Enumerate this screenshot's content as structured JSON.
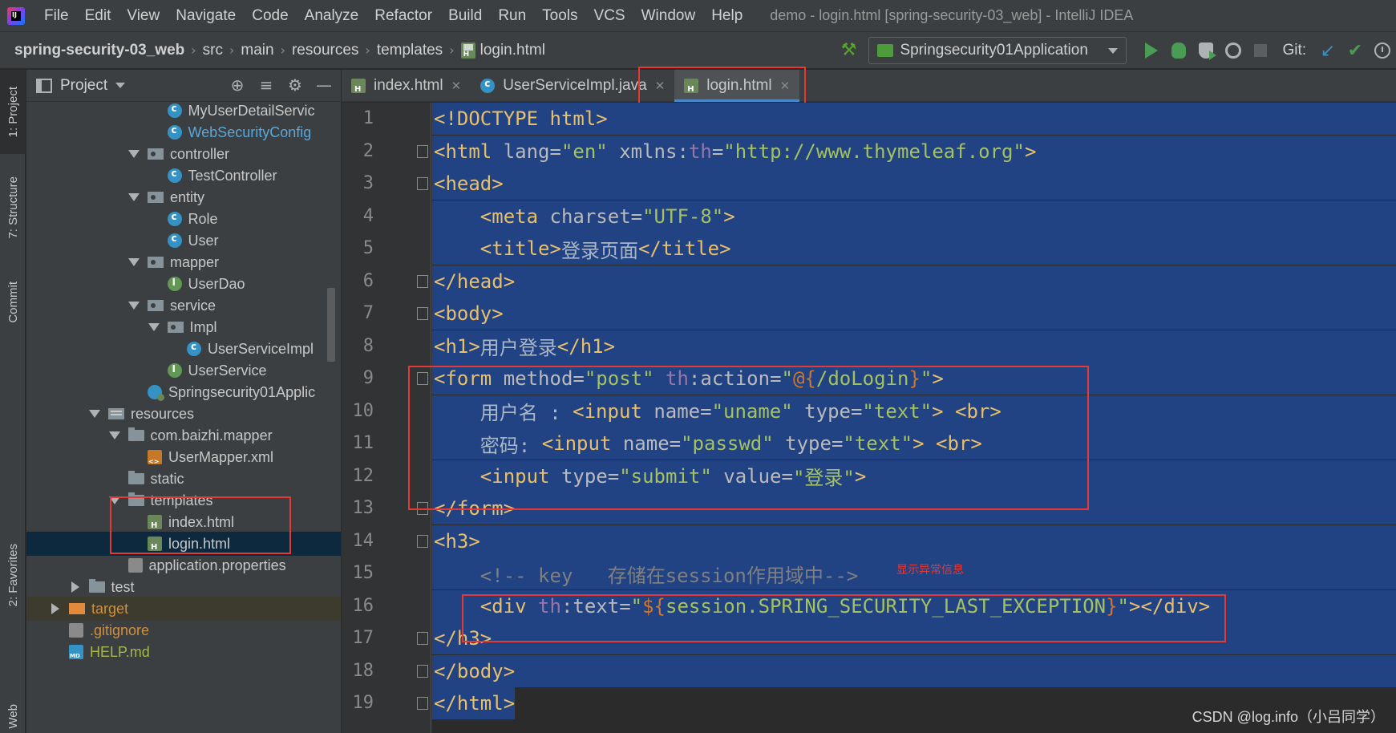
{
  "menu": {
    "logo": "IJ",
    "items": [
      "File",
      "Edit",
      "View",
      "Navigate",
      "Code",
      "Analyze",
      "Refactor",
      "Build",
      "Run",
      "Tools",
      "VCS",
      "Window",
      "Help"
    ],
    "window_title": "demo - login.html [spring-security-03_web] - IntelliJ IDEA"
  },
  "breadcrumb": [
    "spring-security-03_web",
    "src",
    "main",
    "resources",
    "templates",
    "login.html"
  ],
  "toolbar": {
    "run_config": "Springsecurity01Application",
    "git_label": "Git:"
  },
  "tool_strip": {
    "project": "1: Project",
    "structure": "7: Structure",
    "commit": "Commit",
    "favorites": "2: Favorites",
    "web": "Web"
  },
  "project_panel": {
    "title": "Project",
    "tree": [
      {
        "label": "MyUserDetailServic",
        "icon": "class-icon",
        "depth": 7,
        "style": ""
      },
      {
        "label": "WebSecurityConfig",
        "icon": "class-icon",
        "depth": 7,
        "style": "link"
      },
      {
        "label": "controller",
        "icon": "package-icon",
        "depth": 6,
        "arrow": "down"
      },
      {
        "label": "TestController",
        "icon": "class-icon",
        "depth": 7
      },
      {
        "label": "entity",
        "icon": "package-icon",
        "depth": 6,
        "arrow": "down"
      },
      {
        "label": "Role",
        "icon": "class-icon",
        "depth": 7
      },
      {
        "label": "User",
        "icon": "class-icon",
        "depth": 7
      },
      {
        "label": "mapper",
        "icon": "package-icon",
        "depth": 6,
        "arrow": "down"
      },
      {
        "label": "UserDao",
        "icon": "interface-icon",
        "depth": 7
      },
      {
        "label": "service",
        "icon": "package-icon",
        "depth": 6,
        "arrow": "down"
      },
      {
        "label": "Impl",
        "icon": "package-icon",
        "depth": 7,
        "arrow": "down"
      },
      {
        "label": "UserServiceImpl",
        "icon": "class-icon",
        "depth": 8
      },
      {
        "label": "UserService",
        "icon": "interface-icon",
        "depth": 7
      },
      {
        "label": "Springsecurity01Applic",
        "icon": "spring-class-icon",
        "depth": 6
      },
      {
        "label": "resources",
        "icon": "resources-folder-icon",
        "depth": 4,
        "arrow": "down"
      },
      {
        "label": "com.baizhi.mapper",
        "icon": "folder-icon",
        "depth": 5,
        "arrow": "down"
      },
      {
        "label": "UserMapper.xml",
        "icon": "xml-file-icon",
        "depth": 6
      },
      {
        "label": "static",
        "icon": "folder-icon",
        "depth": 5
      },
      {
        "label": "templates",
        "icon": "folder-icon",
        "depth": 5,
        "arrow": "down"
      },
      {
        "label": "index.html",
        "icon": "html-file-icon",
        "depth": 6
      },
      {
        "label": "login.html",
        "icon": "html-file-icon",
        "depth": 6,
        "style": "selected"
      },
      {
        "label": "application.properties",
        "icon": "properties-file-icon",
        "depth": 5
      },
      {
        "label": "test",
        "icon": "folder-icon",
        "depth": 3,
        "arrow": "right"
      },
      {
        "label": "target",
        "icon": "target-folder-icon",
        "depth": 2,
        "arrow": "right",
        "style": "excluded"
      },
      {
        "label": ".gitignore",
        "icon": "gitignore-file-icon",
        "depth": 2,
        "style": "git"
      },
      {
        "label": "HELP.md",
        "icon": "markdown-file-icon",
        "depth": 2,
        "style": "help"
      }
    ]
  },
  "editor_tabs": [
    {
      "label": "index.html",
      "icon": "html-file-icon",
      "active": false
    },
    {
      "label": "UserServiceImpl.java",
      "icon": "class-icon",
      "active": false
    },
    {
      "label": "login.html",
      "icon": "html-file-icon",
      "active": true
    }
  ],
  "code": {
    "line_numbers": [
      "1",
      "2",
      "3",
      "4",
      "5",
      "6",
      "7",
      "8",
      "9",
      "10",
      "11",
      "12",
      "13",
      "14",
      "15",
      "16",
      "17",
      "18",
      "19"
    ],
    "lines": [
      [
        {
          "t": "<!DOCTYPE html>",
          "c": "tag"
        }
      ],
      [
        {
          "t": "<html ",
          "c": "tag"
        },
        {
          "t": "lang=",
          "c": "attr"
        },
        {
          "t": "\"en\"",
          "c": "val"
        },
        {
          "t": " xmlns:",
          "c": "attr"
        },
        {
          "t": "th",
          "c": "ns"
        },
        {
          "t": "=",
          "c": "attr"
        },
        {
          "t": "\"http://www.thymeleaf.org\"",
          "c": "val"
        },
        {
          "t": ">",
          "c": "tag"
        }
      ],
      [
        {
          "t": "<head>",
          "c": "tag"
        }
      ],
      [
        {
          "t": "    ",
          "c": "plain"
        },
        {
          "t": "<meta ",
          "c": "tag"
        },
        {
          "t": "charset=",
          "c": "attr"
        },
        {
          "t": "\"UTF-8\"",
          "c": "val"
        },
        {
          "t": ">",
          "c": "tag"
        }
      ],
      [
        {
          "t": "    ",
          "c": "plain"
        },
        {
          "t": "<title>",
          "c": "tag"
        },
        {
          "t": "登录页面",
          "c": "txt"
        },
        {
          "t": "</title>",
          "c": "tag"
        }
      ],
      [
        {
          "t": "</head>",
          "c": "tag"
        }
      ],
      [
        {
          "t": "<body>",
          "c": "tag"
        }
      ],
      [
        {
          "t": "<h1>",
          "c": "tag"
        },
        {
          "t": "用户登录",
          "c": "txt"
        },
        {
          "t": "</h1>",
          "c": "tag"
        }
      ],
      [
        {
          "t": "<form ",
          "c": "tag"
        },
        {
          "t": "method=",
          "c": "attr"
        },
        {
          "t": "\"post\"",
          "c": "val"
        },
        {
          "t": " ",
          "c": "plain"
        },
        {
          "t": "th",
          "c": "ns"
        },
        {
          "t": ":action=",
          "c": "attr"
        },
        {
          "t": "\"",
          "c": "val"
        },
        {
          "t": "@{",
          "c": "expr"
        },
        {
          "t": "/doLogin",
          "c": "val"
        },
        {
          "t": "}",
          "c": "expr"
        },
        {
          "t": "\"",
          "c": "val"
        },
        {
          "t": ">",
          "c": "tag"
        }
      ],
      [
        {
          "t": "    ",
          "c": "plain"
        },
        {
          "t": "用户名 : ",
          "c": "txt"
        },
        {
          "t": "<input ",
          "c": "tag"
        },
        {
          "t": "name=",
          "c": "attr"
        },
        {
          "t": "\"uname\"",
          "c": "val"
        },
        {
          "t": " type=",
          "c": "attr"
        },
        {
          "t": "\"text\"",
          "c": "val"
        },
        {
          "t": "> ",
          "c": "tag"
        },
        {
          "t": "<br>",
          "c": "tag"
        }
      ],
      [
        {
          "t": "    ",
          "c": "plain"
        },
        {
          "t": "密码: ",
          "c": "txt"
        },
        {
          "t": "<input ",
          "c": "tag"
        },
        {
          "t": "name=",
          "c": "attr"
        },
        {
          "t": "\"passwd\"",
          "c": "val"
        },
        {
          "t": " type=",
          "c": "attr"
        },
        {
          "t": "\"text\"",
          "c": "val"
        },
        {
          "t": "> ",
          "c": "tag"
        },
        {
          "t": "<br>",
          "c": "tag"
        }
      ],
      [
        {
          "t": "    ",
          "c": "plain"
        },
        {
          "t": "<input ",
          "c": "tag"
        },
        {
          "t": "type=",
          "c": "attr"
        },
        {
          "t": "\"submit\"",
          "c": "val"
        },
        {
          "t": " value=",
          "c": "attr"
        },
        {
          "t": "\"登录\"",
          "c": "val"
        },
        {
          "t": ">",
          "c": "tag"
        }
      ],
      [
        {
          "t": "</form>",
          "c": "tag"
        }
      ],
      [
        {
          "t": "<h3>",
          "c": "tag"
        }
      ],
      [
        {
          "t": "    ",
          "c": "plain"
        },
        {
          "t": "<!-- key   存储在session作用域中-->",
          "c": "comment"
        }
      ],
      [
        {
          "t": "    ",
          "c": "plain"
        },
        {
          "t": "<div ",
          "c": "tag"
        },
        {
          "t": "th",
          "c": "ns"
        },
        {
          "t": ":text=",
          "c": "attr"
        },
        {
          "t": "\"",
          "c": "val"
        },
        {
          "t": "${",
          "c": "expr"
        },
        {
          "t": "session.SPRING_SECURITY_LAST_EXCEPTION",
          "c": "val"
        },
        {
          "t": "}",
          "c": "expr"
        },
        {
          "t": "\"",
          "c": "val"
        },
        {
          "t": "></div>",
          "c": "tag"
        }
      ],
      [
        {
          "t": "</h3>",
          "c": "tag"
        }
      ],
      [
        {
          "t": "</body>",
          "c": "tag"
        }
      ],
      [
        {
          "t": "</html>",
          "c": "tag"
        }
      ]
    ],
    "annotation_note": "显示异常信息"
  },
  "watermark": "CSDN @log.info（小吕同学）",
  "colors": {
    "selection": "#214283",
    "tag": "#e8bf6a",
    "value": "#a5c261",
    "namespace": "#9876aa",
    "annotation": "#e53935"
  }
}
